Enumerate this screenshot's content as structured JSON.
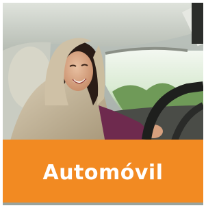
{
  "tile": {
    "category_label": "Automóvil",
    "banner_color": "#f28a22",
    "label_color": "#ffffff"
  },
  "photo": {
    "subject": "woman-driving-car"
  }
}
